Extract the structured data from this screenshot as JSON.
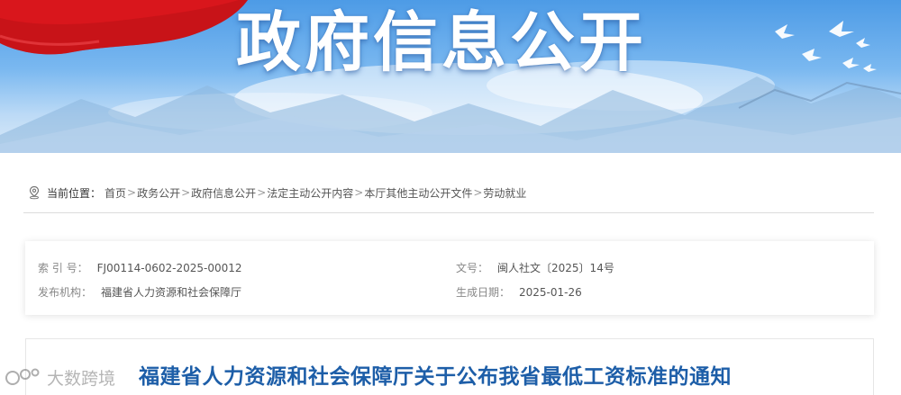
{
  "banner": {
    "title": "政府信息公开"
  },
  "breadcrumb": {
    "label": "当前位置：",
    "items": [
      {
        "text": "首页"
      },
      {
        "text": "政务公开"
      },
      {
        "text": "政府信息公开"
      },
      {
        "text": "法定主动公开内容"
      },
      {
        "text": "本厅其他主动公开文件"
      },
      {
        "text": "劳动就业"
      }
    ],
    "separator": ">"
  },
  "meta": {
    "index_label": "索 引 号：",
    "index_value": "FJ00114-0602-2025-00012",
    "doc_no_label": "文号：",
    "doc_no_value": "闽人社文〔2025〕14号",
    "publisher_label": "发布机构：",
    "publisher_value": "福建省人力资源和社会保障厅",
    "date_label": "生成日期：",
    "date_value": "2025-01-26"
  },
  "document": {
    "title": "福建省人力资源和社会保障厅关于公布我省最低工资标准的通知"
  },
  "watermark": {
    "text": "大数跨境"
  },
  "colors": {
    "title_blue": "#1d5ea8",
    "flag_red": "#d9161c",
    "sky_blue": "#4d9be6"
  }
}
